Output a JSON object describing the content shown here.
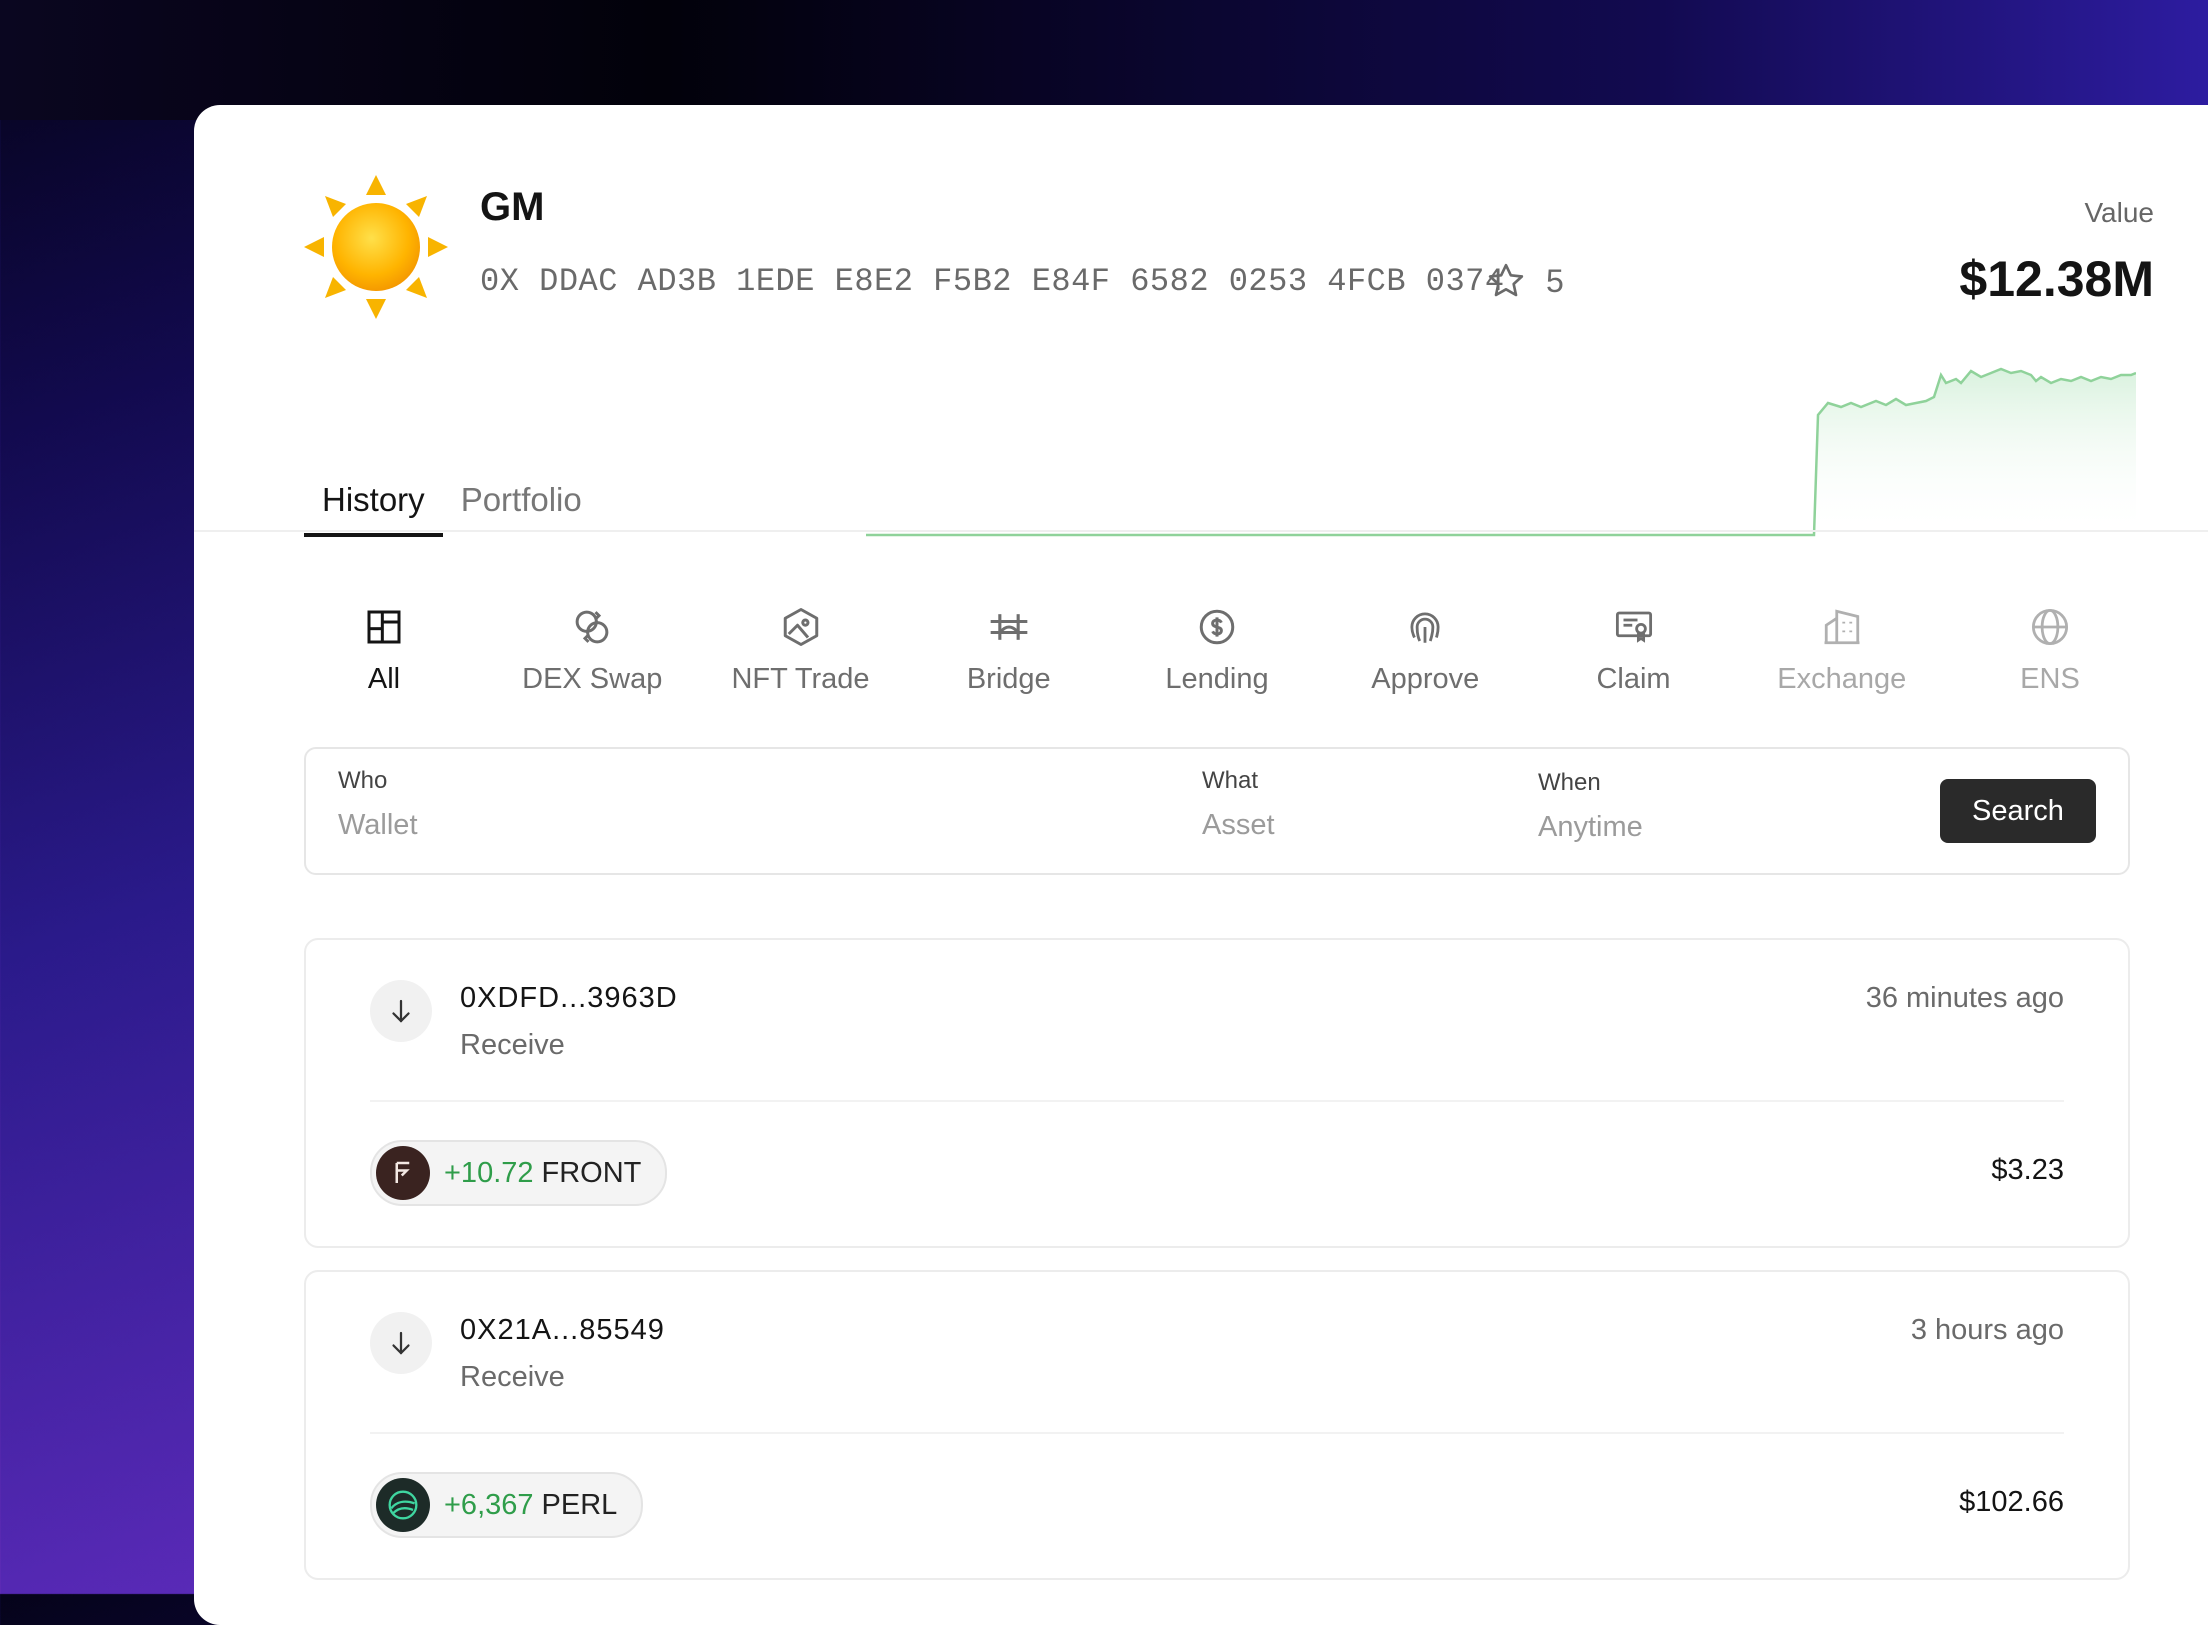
{
  "profile": {
    "name": "GM",
    "address": "0X DDAC AD3B 1EDE E8E2 F5B2 E84F 6582 0253 4FCB 0374",
    "star_count": "5",
    "value_label": "Value",
    "value": "$12.38M"
  },
  "tabs": [
    {
      "label": "History",
      "active": true
    },
    {
      "label": "Portfolio",
      "active": false
    }
  ],
  "categories": [
    {
      "label": "All",
      "icon": "layout-icon"
    },
    {
      "label": "DEX Swap",
      "icon": "swap-icon"
    },
    {
      "label": "NFT Trade",
      "icon": "nft-icon"
    },
    {
      "label": "Bridge",
      "icon": "bridge-icon"
    },
    {
      "label": "Lending",
      "icon": "lending-icon"
    },
    {
      "label": "Approve",
      "icon": "fingerprint-icon"
    },
    {
      "label": "Claim",
      "icon": "certificate-icon"
    },
    {
      "label": "Exchange",
      "icon": "building-icon"
    },
    {
      "label": "ENS",
      "icon": "globe-icon"
    }
  ],
  "search": {
    "who_label": "Who",
    "who_placeholder": "Wallet",
    "what_label": "What",
    "what_placeholder": "Asset",
    "when_label": "When",
    "when_placeholder": "Anytime",
    "button": "Search"
  },
  "transactions": [
    {
      "address": "0XDFD...3963D",
      "kind": "Receive",
      "time": "36 minutes ago",
      "amount": "+10.72",
      "symbol": "FRONT",
      "usd": "$3.23"
    },
    {
      "address": "0X21A...85549",
      "kind": "Receive",
      "time": "3 hours ago",
      "amount": "+6,367",
      "symbol": "PERL",
      "usd": "$102.66"
    }
  ],
  "colors": {
    "positive": "#2f9d4a",
    "chart_line": "#8fd29a",
    "button_bg": "#2a2a2a"
  }
}
